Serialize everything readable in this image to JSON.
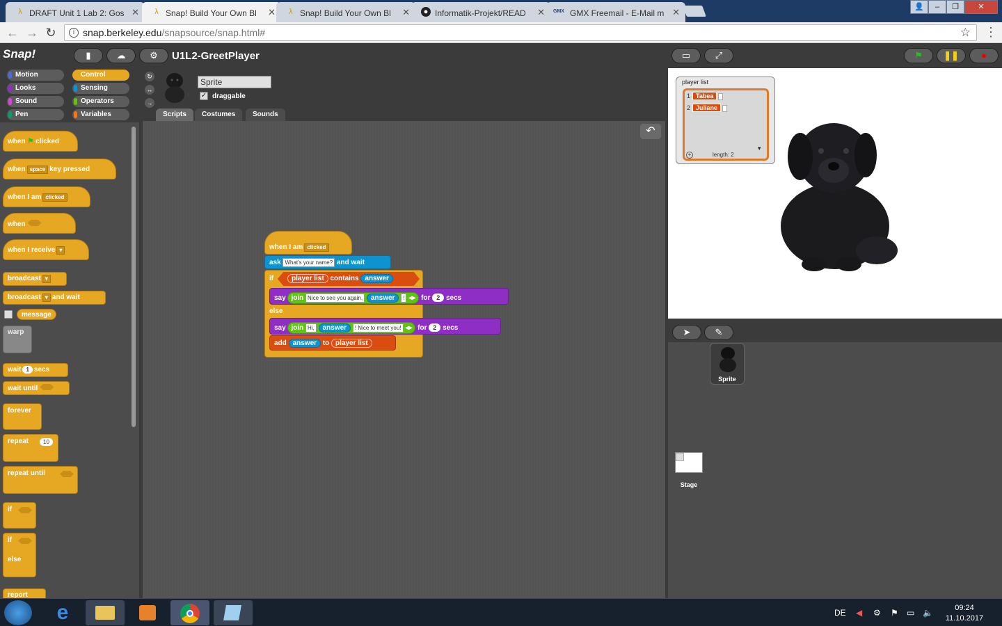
{
  "browser": {
    "tabs": [
      {
        "title": "DRAFT Unit 1 Lab 2: Gos",
        "icon": "snap-lambda-icon",
        "active": false
      },
      {
        "title": "Snap! Build Your Own Bl",
        "icon": "snap-lambda-icon",
        "active": true
      },
      {
        "title": "Snap! Build Your Own Bl",
        "icon": "snap-lambda-icon",
        "active": false
      },
      {
        "title": "Informatik-Projekt/READ",
        "icon": "github-icon",
        "active": false
      },
      {
        "title": "GMX Freemail - E-Mail m",
        "icon": "gmx-icon",
        "active": false
      }
    ],
    "gmx_icon_text": "GMX",
    "url_host": "snap.berkeley.edu",
    "url_path": "/snapsource/snap.html#"
  },
  "snap": {
    "logo_text": "Snap!",
    "project_title": "U1L2-GreetPlayer",
    "categories": [
      "Motion",
      "Looks",
      "Sound",
      "Pen",
      "Control",
      "Sensing",
      "Operators",
      "Variables"
    ],
    "category_colors": {
      "Motion": "#4a6cd4",
      "Looks": "#8e2ec4",
      "Sound": "#cf4ad9",
      "Pen": "#0e9a6c",
      "Control": "#e6a822",
      "Sensing": "#0d94d0",
      "Operators": "#62c213",
      "Variables": "#f3761d"
    },
    "selected_category": "Control",
    "palette": {
      "when_flag_clicked": [
        "when",
        "clicked"
      ],
      "when_key": [
        "when",
        "space",
        "key pressed"
      ],
      "when_i_am": [
        "when I am",
        "clicked"
      ],
      "when_cond": "when",
      "when_receive": "when I receive",
      "broadcast": "broadcast",
      "broadcast_wait": [
        "broadcast",
        "and wait"
      ],
      "message": "message",
      "warp": "warp",
      "wait_secs": [
        "wait",
        "1",
        "secs"
      ],
      "wait_until": "wait until",
      "forever": "forever",
      "repeat": [
        "repeat",
        "10"
      ],
      "repeat_until": "repeat until",
      "if": "if",
      "if_else": [
        "if",
        "else"
      ],
      "report": "report"
    },
    "sprite": {
      "name": "Sprite",
      "draggable_label": "draggable",
      "draggable": true
    },
    "tabs": [
      "Scripts",
      "Costumes",
      "Sounds"
    ],
    "selected_tab": "Scripts",
    "script": {
      "hat": [
        "when I am",
        "clicked"
      ],
      "ask": [
        "ask",
        "What's your name?",
        "and wait"
      ],
      "if": "if",
      "contains": [
        "player list",
        "contains",
        "answer"
      ],
      "say1": [
        "say",
        "join",
        "Nice to see you again, ",
        "answer",
        "!",
        "for",
        "2",
        "secs"
      ],
      "else": "else",
      "say2": [
        "say",
        "join",
        "Hi, ",
        "answer",
        "! Nice to meet you!",
        "for",
        "2",
        "secs"
      ],
      "add": [
        "add",
        "answer",
        "to",
        "player list"
      ]
    },
    "watcher": {
      "title": "player list",
      "items": [
        {
          "index": "1",
          "value": "Tabea"
        },
        {
          "index": "2",
          "value": "Juliane"
        }
      ],
      "length_label": "length: 2"
    },
    "corral": {
      "sprite_label": "Sprite",
      "stage_label": "Stage"
    }
  },
  "taskbar": {
    "lang": "DE",
    "time": "09:24",
    "date": "11.10.2017"
  }
}
